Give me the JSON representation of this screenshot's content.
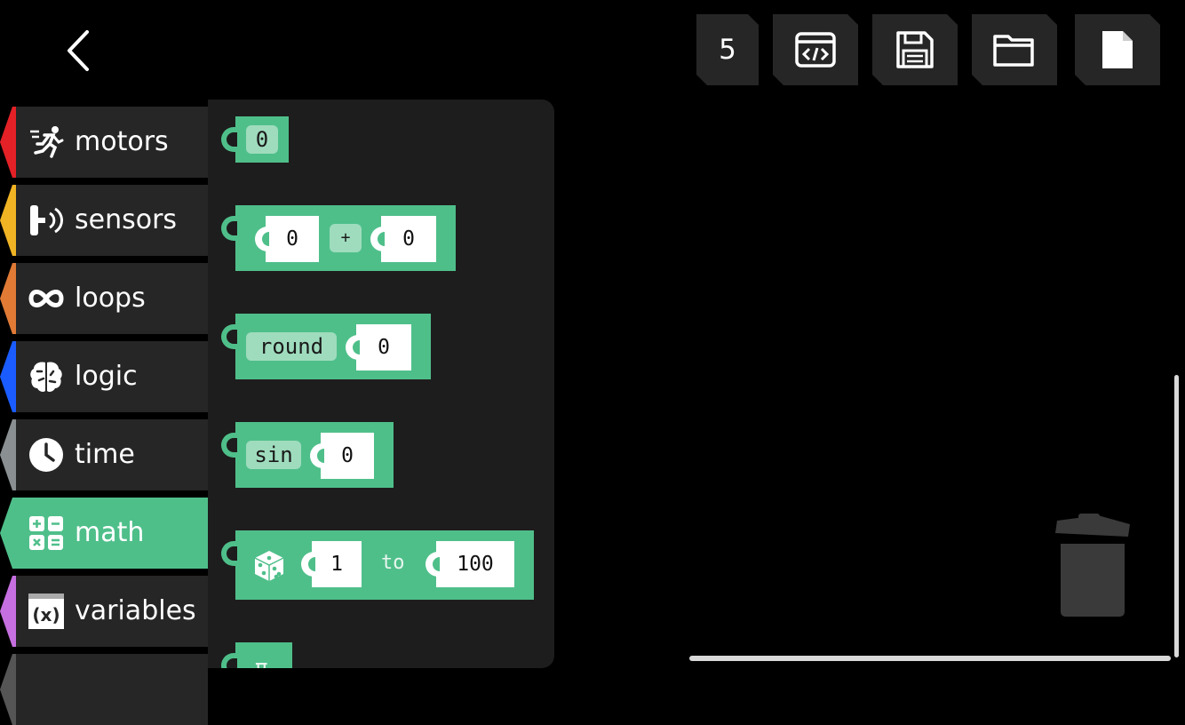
{
  "toolbar": {
    "level_count": "5",
    "buttons": [
      {
        "name": "code-view-button",
        "icon": "code-window-icon"
      },
      {
        "name": "save-button",
        "icon": "floppy-disk-icon"
      },
      {
        "name": "open-button",
        "icon": "folder-icon"
      },
      {
        "name": "new-file-button",
        "icon": "file-icon"
      }
    ],
    "back_icon": "chevron-left-icon"
  },
  "categories": [
    {
      "label": "motors",
      "icon": "running-figure-icon",
      "color": "#e32127"
    },
    {
      "label": "sensors",
      "icon": "sensor-wave-icon",
      "color": "#f0b323"
    },
    {
      "label": "loops",
      "icon": "infinity-icon",
      "color": "#e07a35"
    },
    {
      "label": "logic",
      "icon": "brain-icon",
      "color": "#1a5cff"
    },
    {
      "label": "time",
      "icon": "clock-icon",
      "color": "#8a8f91"
    },
    {
      "label": "math",
      "icon": "calculator-icon",
      "color": "#4fbf8a",
      "active": true
    },
    {
      "label": "variables",
      "icon": "function-x-icon",
      "color": "#c66fe0"
    }
  ],
  "blocks": {
    "number": {
      "value": "0"
    },
    "arith": {
      "left": "0",
      "op": "+",
      "right": "0"
    },
    "round": {
      "keyword": "round",
      "value": "0"
    },
    "sin": {
      "keyword": "sin",
      "value": "0"
    },
    "random": {
      "icon": "dice-icon",
      "from": "1",
      "to_label": "to",
      "to": "100"
    },
    "pi": {
      "symbol": "π"
    }
  },
  "colors": {
    "math_block": "#4fbf8a",
    "background": "#000000",
    "flyout": "#1d1d1d",
    "sidebar_item": "#262626"
  },
  "trash_icon": "trash-can-icon"
}
